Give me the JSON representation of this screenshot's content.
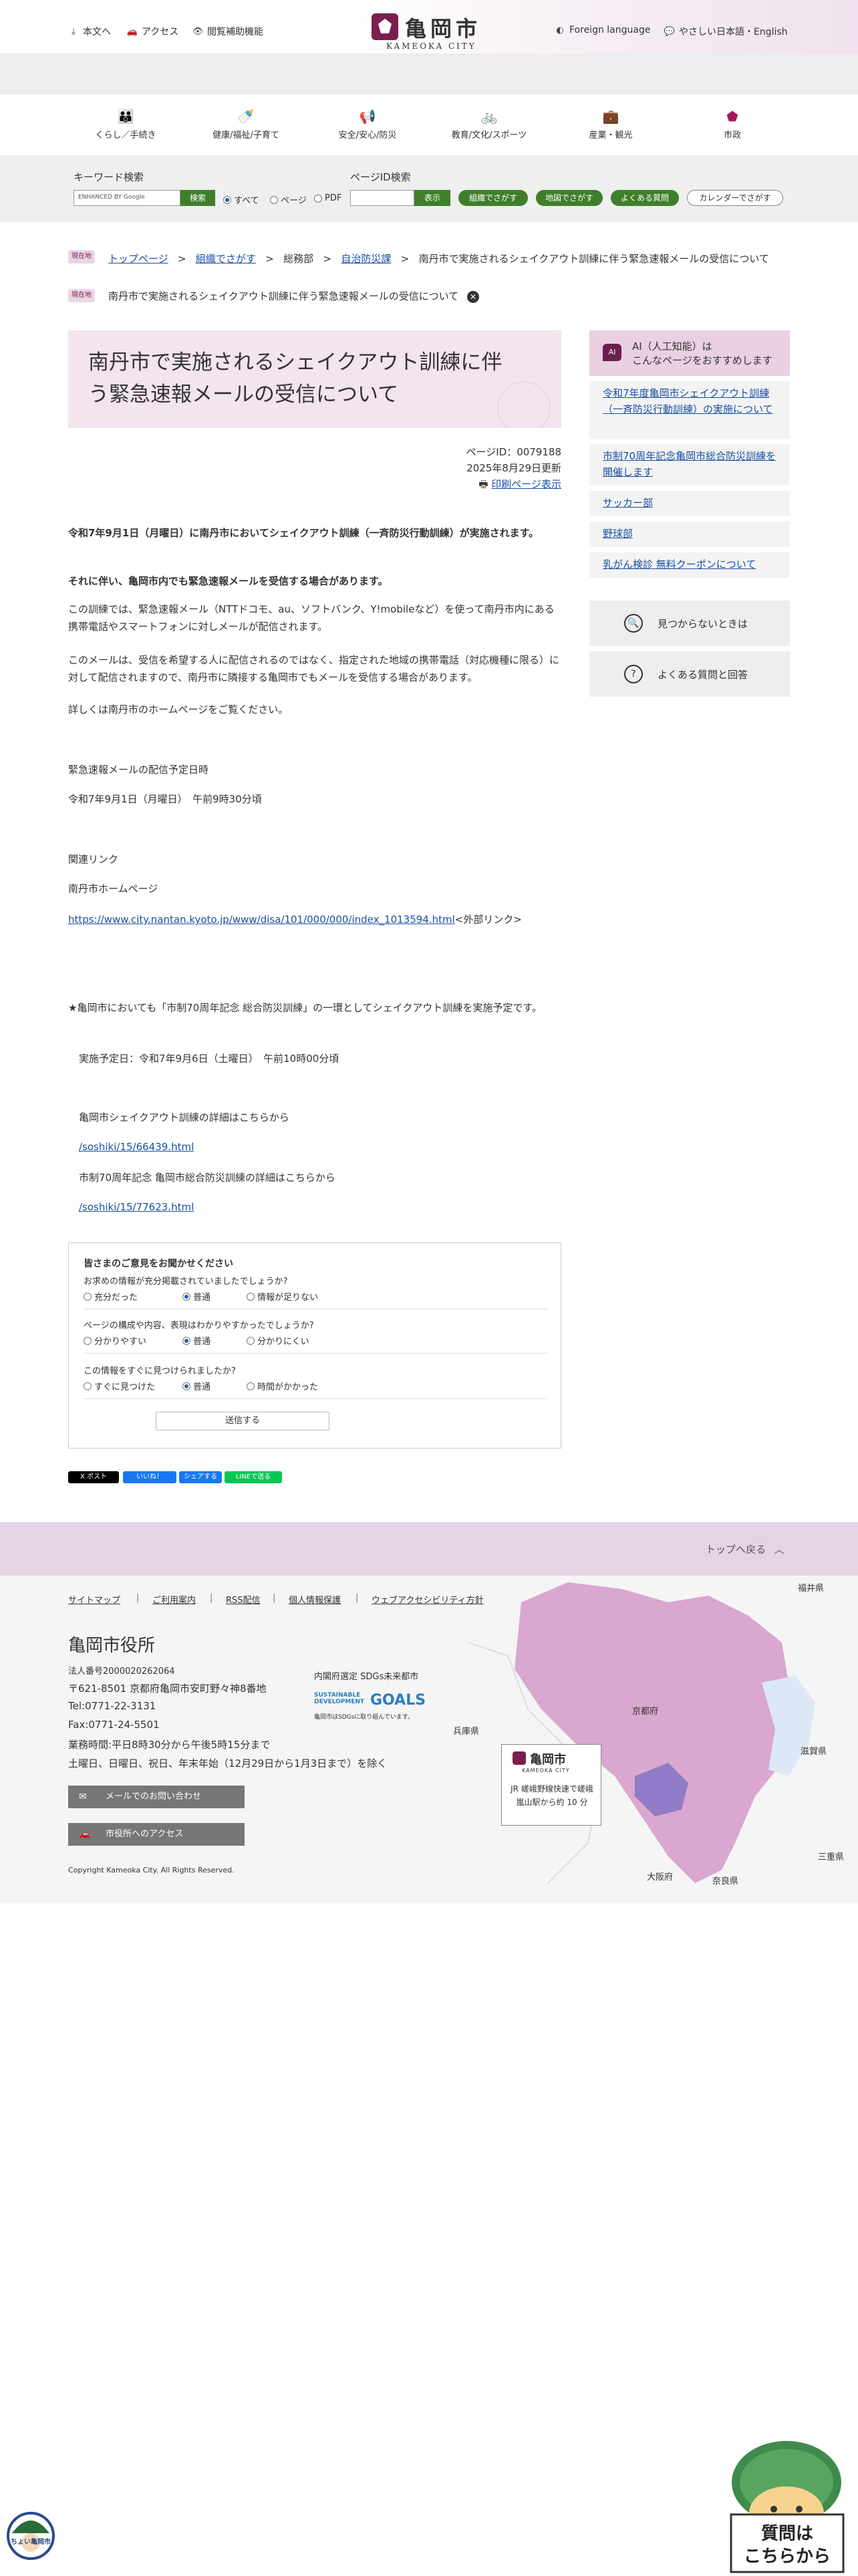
{
  "header": {
    "links": [
      {
        "label": "本文へ",
        "icon": "download-icon"
      },
      {
        "label": "アクセス",
        "icon": "car-icon"
      },
      {
        "label": "閲覧補助機能",
        "icon": "eye-icon"
      }
    ],
    "logo_name": "亀岡市",
    "logo_sub": "KAMEOKA CITY",
    "foreign_language": "Foreign language",
    "easy_japanese": "やさしい日本語・English"
  },
  "global_nav": [
    {
      "label": "くらし／手続き",
      "icon": "people-icon"
    },
    {
      "label": "健康/福祉/子育て",
      "icon": "bottle-icon"
    },
    {
      "label": "安全/安心/防災",
      "icon": "megaphone-icon"
    },
    {
      "label": "教育/文化/スポーツ",
      "icon": "bicycle-icon"
    },
    {
      "label": "産業・観光",
      "icon": "briefcase-icon"
    },
    {
      "label": "市政",
      "icon": "city-emblem-icon"
    }
  ],
  "search": {
    "keyword_label": "キーワード検索",
    "google_placeholder": "ENHANCED BY Google",
    "search_button": "検索",
    "radios": [
      {
        "label": "すべて",
        "checked": true
      },
      {
        "label": "ページ",
        "checked": false
      },
      {
        "label": "PDF",
        "checked": false
      }
    ],
    "pageid_label": "ページID検索",
    "pageid_button": "表示",
    "pills": [
      "組織でさがす",
      "地図でさがす",
      "よくある質問",
      "カレンダーでさがす"
    ]
  },
  "breadcrumb": {
    "tag1": "現在地",
    "items": [
      "トップページ",
      "組織でさがす",
      "総務部",
      "自治防災課",
      "南丹市で実施されるシェイクアウト訓練に伴う緊急速報メールの受信について"
    ],
    "tag2": "現在地",
    "current": "南丹市で実施されるシェイクアウト訓練に伴う緊急速報メールの受信について"
  },
  "page": {
    "title": "南丹市で実施されるシェイクアウト訓練に伴う緊急速報メールの受信について",
    "page_id": "ページID：0079188",
    "updated": "2025年8月29日更新",
    "print": "印刷ページ表示",
    "lead1": "令和7年9月1日（月曜日）に南丹市においてシェイクアウト訓練（一斉防災行動訓練）が実施されます。",
    "lead2": "それに伴い、亀岡市内でも緊急速報メールを受信する場合があります。",
    "p1": "この訓練では、緊急速報メール（NTTドコモ、au、ソフトバンク、Y!mobileなど）を使って南丹市内にある携帯電話やスマートフォンに対しメールが配信されます。",
    "p2": "このメールは、受信を希望する人に配信されるのではなく、指定された地域の携帯電話（対応機種に限る）に対して配信されますので、南丹市に隣接する亀岡市でもメールを受信する場合があります。",
    "p3": "詳しくは南丹市のホームページをご覧ください。",
    "schedule_label": "緊急速報メールの配信予定日時",
    "schedule_value": "令和7年9月1日（月曜日）　午前9時30分頃",
    "related_label": "関連リンク",
    "related_site": "南丹市ホームページ",
    "related_url": "https://www.city.nantan.kyoto.jp/www/disa/101/000/000/index_1013594.html",
    "external": "<外部リンク>",
    "kameoka_note": "★亀岡市においても「市制70周年記念 総合防災訓練」の一環としてシェイクアウト訓練を実施予定です。",
    "kameoka_date": "実施予定日：令和7年9月6日（土曜日）　午前10時00分頃",
    "detail1_label": "亀岡市シェイクアウト訓練の詳細はこちらから",
    "detail1_url": "/soshiki/15/66439.html",
    "detail2_label": "市制70周年記念 亀岡市総合防災訓練の詳細はこちらから",
    "detail2_url": "/soshiki/15/77623.html"
  },
  "sidebar": {
    "head_line1": "AI（人工知能）は",
    "head_line2": "こんなページをおすすめします",
    "ai_badge": "AI",
    "links": [
      "令和7年度亀岡市シェイクアウト訓練（一斉防災行動訓練）の実施について",
      "市制70周年記念亀岡市総合防災訓練を開催します",
      "サッカー部",
      "野球部",
      "乳がん検診 無料クーポンについて"
    ],
    "not_found": "見つからないときは",
    "faq": "よくある質問と回答"
  },
  "survey": {
    "title": "皆さまのご意見をお聞かせください",
    "q1": "お求めの情報が充分掲載されていましたでしょうか?",
    "q1_options": [
      "充分だった",
      "普通",
      "情報が足りない"
    ],
    "q2": "ページの構成や内容、表現はわかりやすかったでしょうか?",
    "q2_options": [
      "分かりやすい",
      "普通",
      "分かりにくい"
    ],
    "q3": "この情報をすぐに見つけられましたか?",
    "q3_options": [
      "すぐに見つけた",
      "普通",
      "時間がかかった"
    ],
    "submit": "送信する"
  },
  "social": {
    "x": "X ポスト",
    "fb_like": "いいね！",
    "fb_share": "シェアする",
    "line": "LINEで送る"
  },
  "footer": {
    "page_top": "トップへ戻る",
    "links": [
      "サイトマップ",
      "ご利用案内",
      "RSS配信",
      "個人情報保護",
      "ウェブアクセシビリティ方針"
    ],
    "office": "亀岡市役所",
    "corp_no": "法人番号2000020262064",
    "address": "〒621-8501 京都府亀岡市安町野々神8番地",
    "tel": "Tel:0771-22-3131",
    "fax": "Fax:0771-24-5501",
    "hours1": "業務時間:平日8時30分から午後5時15分まで",
    "hours2": "土曜日、日曜日、祝日、年末年始（12月29日から1月3日まで）を除く",
    "mail_btn": "メールでのお問い合わせ",
    "access_btn": "市役所へのアクセス",
    "copyright": "Copyright Kameoka City. All Rights Reserved.",
    "sdgs_label": "内閣府選定 SDGs未来都市",
    "sdgs_logo_top": "SUSTAINABLE DEVELOPMENT",
    "sdgs_logo_goals": "GOALS",
    "sdgs_logo_bottom": "亀岡市はSDGsに取り組んでいます。",
    "map_labels": {
      "fukui": "福井県",
      "kyoto": "京都府",
      "hyogo": "兵庫県",
      "shiga": "滋賀県",
      "mie": "三重県",
      "osaka": "大阪府",
      "nara": "奈良県"
    },
    "map_card_logo": "亀岡市",
    "map_card_sub": "KAMEOKA CITY",
    "map_card_text": "JR 嵯峨野線快速で嵯峨嵐山駅から約 10 分"
  },
  "mascots": {
    "left_text": "ちょい亀岡市",
    "right_text": "質問は\nこちらから"
  }
}
